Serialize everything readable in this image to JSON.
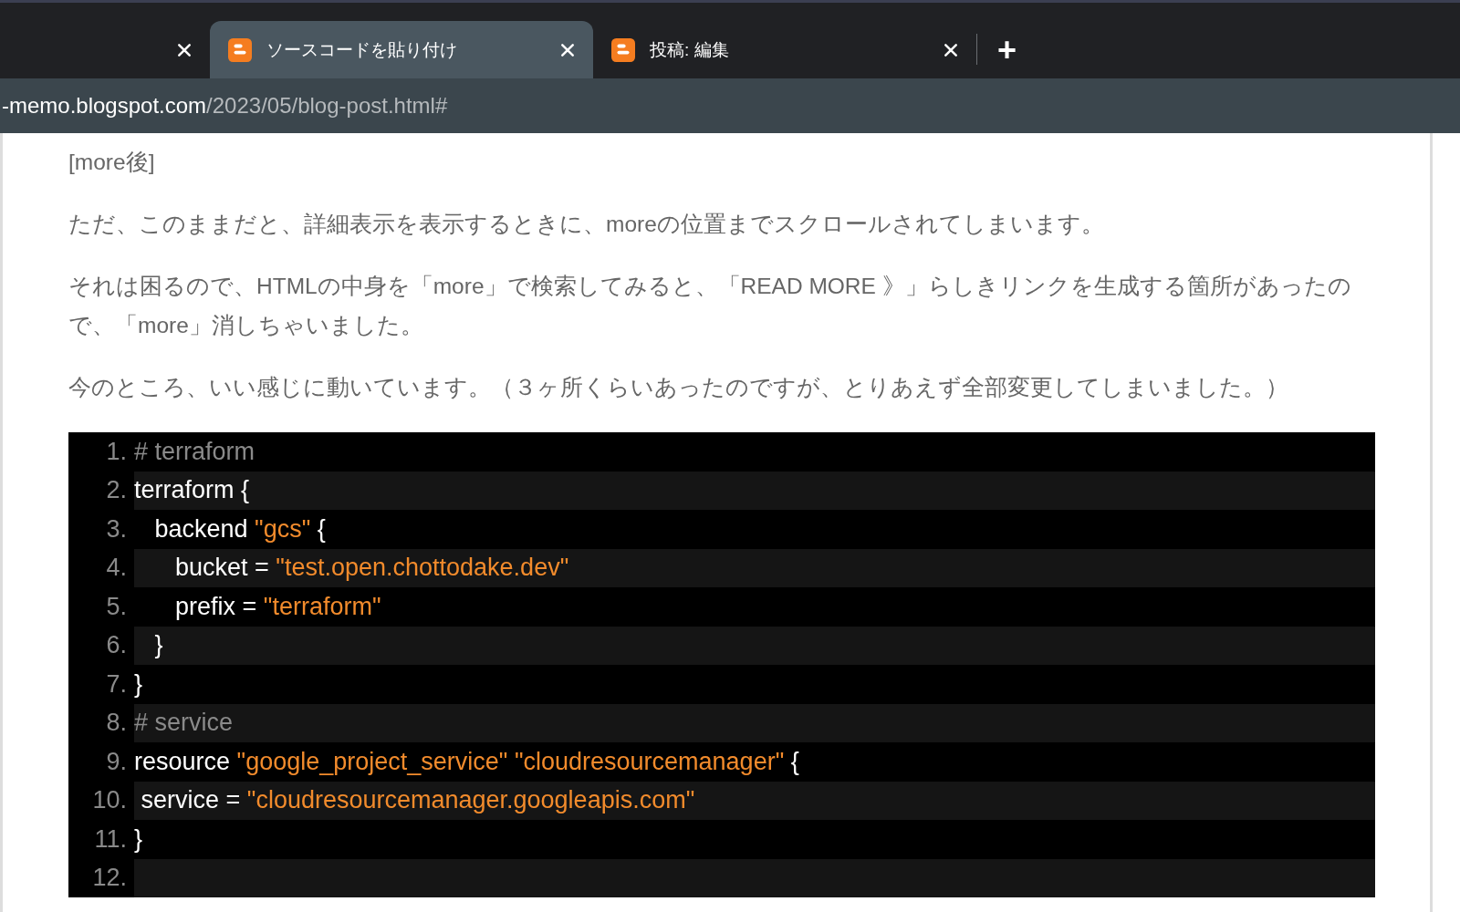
{
  "tabs": [
    {
      "selected": false
    },
    {
      "title": "ソースコードを貼り付け",
      "selected": true
    },
    {
      "title": "投稿: 編集",
      "selected": false
    }
  ],
  "new_tab": "+",
  "address_bar": {
    "host": "-memo.blogspot.com",
    "path": "/2023/05/blog-post.html#"
  },
  "paragraphs": [
    "[more後]",
    "ただ、このままだと、詳細表示を表示するときに、moreの位置までスクロールされてしまいます。",
    "それは困るので、HTMLの中身を「more」で検索してみると、「READ MORE 》」らしきリンクを生成する箇所があったので、「more」消しちゃいました。",
    "今のところ、いい感じに動いています。（３ヶ所くらいあったのですが、とりあえず全部変更してしまいました。）"
  ],
  "code_lines": [
    {
      "number": "1.",
      "tokens": [
        {
          "kind": "comment",
          "text": "# terraform"
        }
      ]
    },
    {
      "number": "2.",
      "tokens": [
        {
          "kind": "plain",
          "text": "terraform {"
        }
      ]
    },
    {
      "number": "3.",
      "tokens": [
        {
          "kind": "plain",
          "text": "   backend "
        },
        {
          "kind": "string",
          "text": "\"gcs\""
        },
        {
          "kind": "plain",
          "text": " {"
        }
      ]
    },
    {
      "number": "4.",
      "tokens": [
        {
          "kind": "plain",
          "text": "      bucket = "
        },
        {
          "kind": "string",
          "text": "\"test.open.chottodake.dev\""
        }
      ]
    },
    {
      "number": "5.",
      "tokens": [
        {
          "kind": "plain",
          "text": "      prefix = "
        },
        {
          "kind": "string",
          "text": "\"terraform\""
        }
      ]
    },
    {
      "number": "6.",
      "tokens": [
        {
          "kind": "plain",
          "text": "   }"
        }
      ]
    },
    {
      "number": "7.",
      "tokens": [
        {
          "kind": "plain",
          "text": "}"
        }
      ]
    },
    {
      "number": "8.",
      "tokens": [
        {
          "kind": "comment",
          "text": "# service"
        }
      ]
    },
    {
      "number": "9.",
      "tokens": [
        {
          "kind": "plain",
          "text": "resource "
        },
        {
          "kind": "string",
          "text": "\"google_project_service\" \"cloudresourcemanager\""
        },
        {
          "kind": "plain",
          "text": " {"
        }
      ]
    },
    {
      "number": "10.",
      "tokens": [
        {
          "kind": "plain",
          "text": " service = "
        },
        {
          "kind": "string",
          "text": "\"cloudresourcemanager.googleapis.com\""
        }
      ]
    },
    {
      "number": "11.",
      "tokens": [
        {
          "kind": "plain",
          "text": "}"
        }
      ]
    },
    {
      "number": "12."
    }
  ]
}
